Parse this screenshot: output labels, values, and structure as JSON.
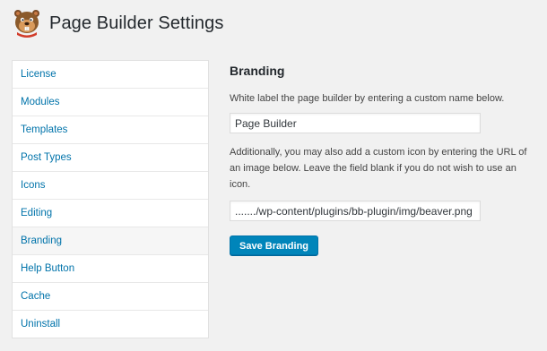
{
  "header": {
    "title": "Page Builder Settings",
    "logo_icon": "beaver-logo-icon"
  },
  "sidebar": {
    "items": [
      {
        "label": "License",
        "active": false
      },
      {
        "label": "Modules",
        "active": false
      },
      {
        "label": "Templates",
        "active": false
      },
      {
        "label": "Post Types",
        "active": false
      },
      {
        "label": "Icons",
        "active": false
      },
      {
        "label": "Editing",
        "active": false
      },
      {
        "label": "Branding",
        "active": true
      },
      {
        "label": "Help Button",
        "active": false
      },
      {
        "label": "Cache",
        "active": false
      },
      {
        "label": "Uninstall",
        "active": false
      }
    ]
  },
  "main": {
    "section_title": "Branding",
    "name_description": "White label the page builder by entering a custom name below.",
    "name_value": "Page Builder",
    "icon_description": "Additionally, you may also add a custom icon by entering the URL of an image below. Leave the field blank if you do not wish to use an icon.",
    "icon_url_value": "......./wp-content/plugins/bb-plugin/img/beaver.png",
    "save_label": "Save Branding"
  },
  "colors": {
    "link": "#0073aa",
    "button_bg": "#0085ba",
    "background": "#f1f1f1"
  }
}
